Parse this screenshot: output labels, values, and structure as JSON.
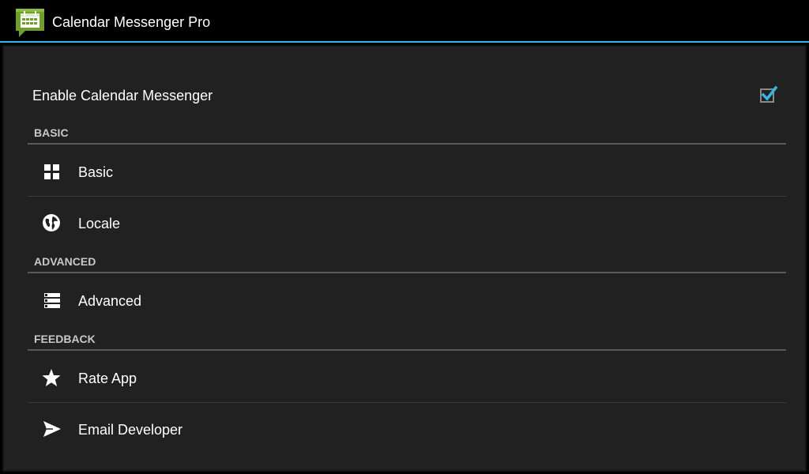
{
  "app": {
    "title": "Calendar Messenger Pro",
    "icon": "calendar-message-icon"
  },
  "colors": {
    "accent": "#33b5e5",
    "background": "#212121",
    "app_icon_green": "#6f9e2a"
  },
  "enable": {
    "label": "Enable Calendar Messenger",
    "checked": true
  },
  "sections": {
    "basic": {
      "header": "BASIC",
      "items": [
        {
          "label": "Basic",
          "icon": "grid-icon"
        },
        {
          "label": "Locale",
          "icon": "globe-icon"
        }
      ]
    },
    "advanced": {
      "header": "ADVANCED",
      "items": [
        {
          "label": "Advanced",
          "icon": "list-icon"
        }
      ]
    },
    "feedback": {
      "header": "FEEDBACK",
      "items": [
        {
          "label": "Rate App",
          "icon": "star-icon"
        },
        {
          "label": "Email Developer",
          "icon": "send-icon"
        }
      ]
    }
  }
}
